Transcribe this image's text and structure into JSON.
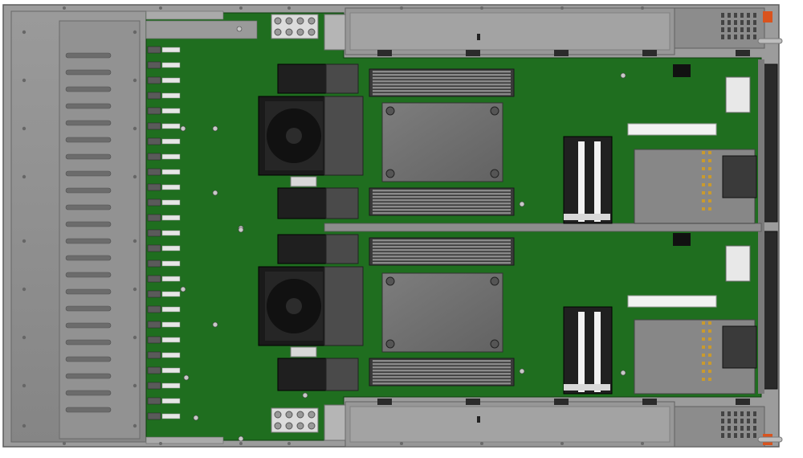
{
  "image": {
    "subject": "server-chassis-top-view",
    "colors": {
      "background": "#ffffff",
      "pcb": "#1e6b1e",
      "pcb_dark": "#155a15",
      "chassis": "#8a8a8a",
      "chassis_light": "#b2b2b2",
      "chassis_dark": "#5e5e5e",
      "component_dark": "#1c1c1c",
      "heatsink": "#6e6e6e",
      "dimm": "#7a7a7a",
      "latch": "#d9531e",
      "pad": "#c99a2e",
      "riser_white": "#f2f2f2"
    }
  }
}
